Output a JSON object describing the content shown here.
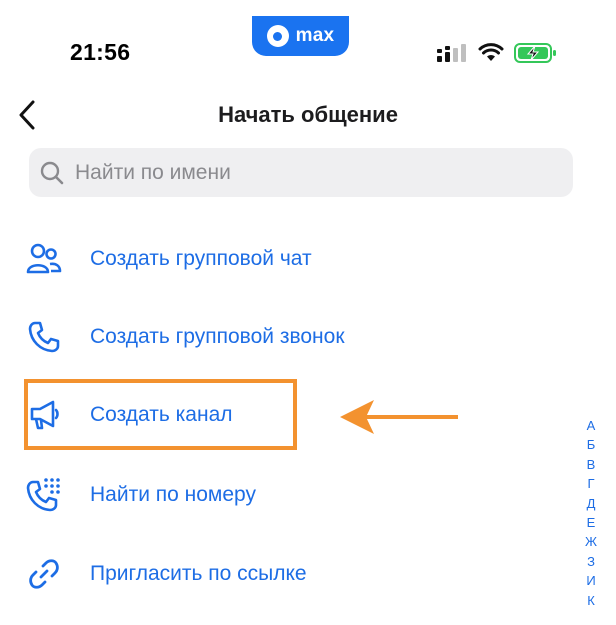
{
  "status_bar": {
    "time": "21:56",
    "app_name": "max"
  },
  "header": {
    "title": "Начать общение",
    "back_icon": "chevron-left-icon"
  },
  "search": {
    "placeholder": "Найти по имени",
    "value": ""
  },
  "menu": [
    {
      "label": "Создать групповой чат",
      "icon": "people-group-icon"
    },
    {
      "label": "Создать групповой звонок",
      "icon": "phone-icon"
    },
    {
      "label": "Создать канал",
      "icon": "megaphone-icon"
    },
    {
      "label": "Найти по номеру",
      "icon": "phone-keypad-icon"
    },
    {
      "label": "Пригласить по ссылке",
      "icon": "link-icon"
    }
  ],
  "alphabet_index": [
    "А",
    "Б",
    "В",
    "Г",
    "Д",
    "Е",
    "Ж",
    "З",
    "И",
    "К"
  ],
  "colors": {
    "accent": "#1d6de5",
    "brand": "#1a73f0",
    "highlight": "#f3922f",
    "battery": "#34c759"
  }
}
